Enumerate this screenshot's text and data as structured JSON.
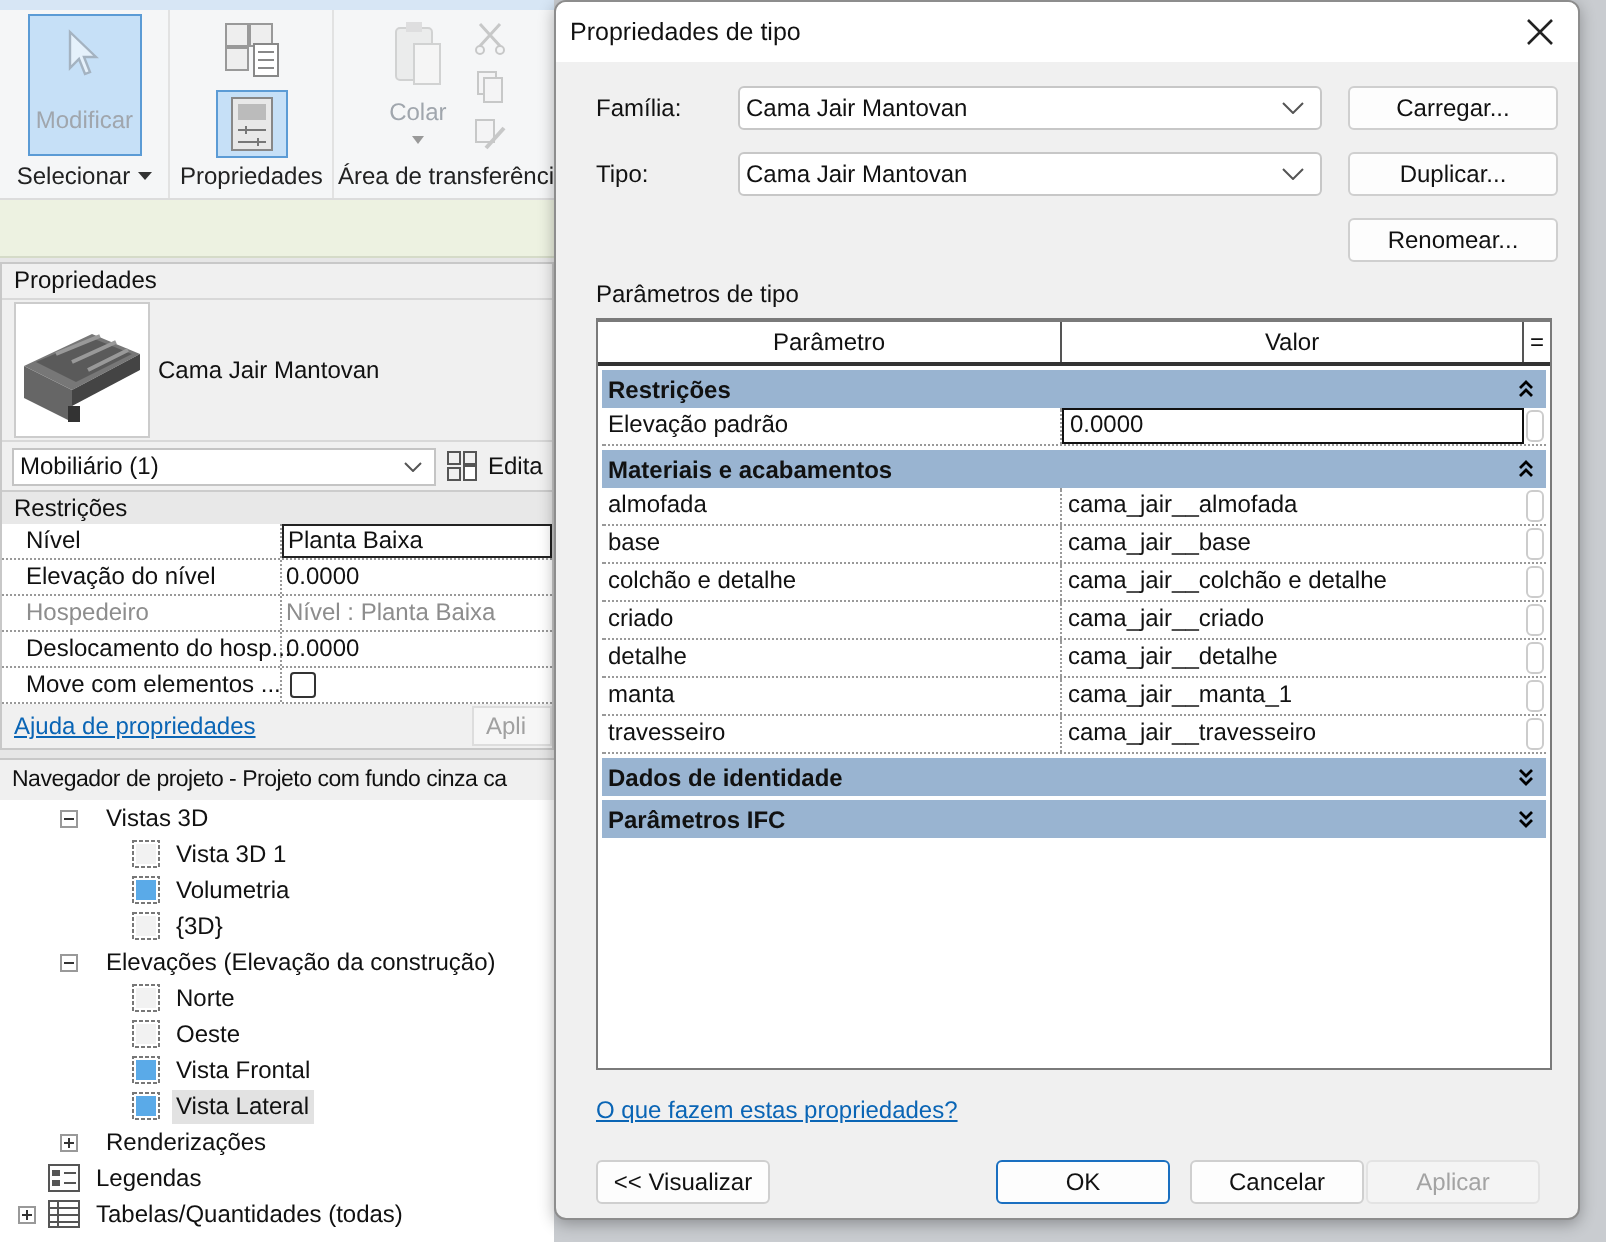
{
  "ribbon": {
    "panels": [
      {
        "label": "Selecionar",
        "dropdown": true,
        "tools": [
          {
            "kind": "modify",
            "label": "Modificar",
            "selected": true,
            "disabled": true
          }
        ]
      },
      {
        "label": "Propriedades",
        "tools": [
          {
            "kind": "type-properties",
            "selected": false
          },
          {
            "kind": "properties",
            "selected": true
          }
        ]
      },
      {
        "label": "Área de transferênci",
        "tools": [
          {
            "kind": "paste",
            "label": "Colar",
            "disabled": true
          },
          {
            "kind": "cut",
            "disabled": true
          },
          {
            "kind": "copy",
            "disabled": true
          },
          {
            "kind": "match",
            "disabled": true
          }
        ]
      }
    ]
  },
  "properties": {
    "title": "Propriedades",
    "preview_name": "Cama Jair Mantovan",
    "selector": "Mobiliário (1)",
    "edit_type": "Edita",
    "group": "Restrições",
    "rows": [
      {
        "kind": "text",
        "label": "Nível",
        "value": "Planta Baixa",
        "selected": true,
        "disabled": false
      },
      {
        "kind": "text",
        "label": "Elevação do nível",
        "value": "0.0000",
        "selected": false,
        "disabled": false
      },
      {
        "kind": "text",
        "label": "Hospedeiro",
        "value": "Nível : Planta Baixa",
        "selected": false,
        "disabled": true
      },
      {
        "kind": "text",
        "label": "Deslocamento do hosp...",
        "value": "0.0000",
        "selected": false,
        "disabled": false
      },
      {
        "kind": "checkbox",
        "label": "Move com elementos ...",
        "checked": false,
        "selected": false,
        "disabled": false
      }
    ],
    "help_link": "Ajuda de propriedades",
    "apply": "Apli"
  },
  "browser": {
    "title": "Navegador de projeto - Projeto com fundo cinza ca",
    "tree": [
      {
        "kind": "group",
        "children": [
          {
            "label": "Vistas 3D",
            "expanded": true,
            "children": [
              {
                "kind": "view",
                "label": "Vista 3D 1",
                "on_sheet": false,
                "selected": false
              },
              {
                "kind": "view",
                "label": "Volumetria",
                "on_sheet": true,
                "selected": false
              },
              {
                "kind": "view",
                "label": "{3D}",
                "on_sheet": false,
                "selected": false
              }
            ]
          },
          {
            "label": "Elevações (Elevação da construção)",
            "expanded": true,
            "children": [
              {
                "kind": "view",
                "label": "Norte",
                "on_sheet": false,
                "selected": false
              },
              {
                "kind": "view",
                "label": "Oeste",
                "on_sheet": false,
                "selected": false
              },
              {
                "kind": "view",
                "label": "Vista Frontal",
                "on_sheet": true,
                "selected": false
              },
              {
                "kind": "view",
                "label": "Vista Lateral",
                "on_sheet": true,
                "selected": true
              }
            ]
          },
          {
            "label": "Renderizações",
            "expanded": false
          }
        ]
      },
      {
        "kind": "legend",
        "label": "Legendas"
      },
      {
        "kind": "schedule",
        "label": "Tabelas/Quantidades (todas)",
        "expanded": false
      }
    ]
  },
  "dialog": {
    "title": "Propriedades de tipo",
    "fields": [
      {
        "label": "Família:",
        "value": "Cama Jair Mantovan",
        "button": "Carregar..."
      },
      {
        "label": "Tipo:",
        "value": "Cama Jair Mantovan",
        "button": "Duplicar..."
      }
    ],
    "extra_button": "Renomear...",
    "params_label": "Parâmetros de tipo",
    "table": {
      "columns": [
        "Parâmetro",
        "Valor",
        "="
      ],
      "groups": [
        {
          "name": "Restrições",
          "expanded": true,
          "rows": [
            {
              "parameter": "Elevação padrão",
              "value": "0.0000",
              "selected": true
            }
          ]
        },
        {
          "name": "Materiais e acabamentos",
          "expanded": true,
          "rows": [
            {
              "parameter": "almofada",
              "value": "cama_jair__almofada",
              "selected": false
            },
            {
              "parameter": "base",
              "value": "cama_jair__base",
              "selected": false
            },
            {
              "parameter": "colchão e detalhe",
              "value": "cama_jair__colchão e detalhe",
              "selected": false
            },
            {
              "parameter": "criado",
              "value": "cama_jair__criado",
              "selected": false
            },
            {
              "parameter": "detalhe",
              "value": "cama_jair__detalhe",
              "selected": false
            },
            {
              "parameter": "manta",
              "value": "cama_jair__manta_1",
              "selected": false
            },
            {
              "parameter": "travesseiro",
              "value": "cama_jair__travesseiro",
              "selected": false
            }
          ]
        },
        {
          "name": "Dados de identidade",
          "expanded": false
        },
        {
          "name": "Parâmetros IFC",
          "expanded": false
        }
      ]
    },
    "help_link": "O que fazem estas propriedades?",
    "buttons": [
      {
        "label": "<< Visualizar",
        "default": false,
        "disabled": false
      },
      {
        "label": "OK",
        "default": true,
        "disabled": false
      },
      {
        "label": "Cancelar",
        "default": false,
        "disabled": false
      },
      {
        "label": "Aplicar",
        "default": false,
        "disabled": true
      }
    ]
  }
}
